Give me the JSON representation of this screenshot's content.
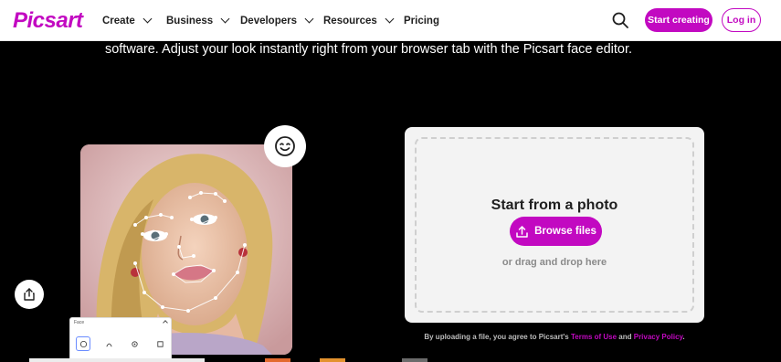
{
  "nav": {
    "logo": "Picsart",
    "menu": [
      {
        "label": "Create",
        "has_dropdown": true
      },
      {
        "label": "Business",
        "has_dropdown": true
      },
      {
        "label": "Developers",
        "has_dropdown": true
      },
      {
        "label": "Resources",
        "has_dropdown": true
      },
      {
        "label": "Pricing",
        "has_dropdown": false
      }
    ],
    "search_icon": "search-icon",
    "start_creating": "Start creating",
    "log_in": "Log in"
  },
  "hero": {
    "text": "software. Adjust your look instantly right from your browser tab with the Picsart face editor."
  },
  "upload": {
    "title": "Start from a photo",
    "browse_label": "Browse files",
    "drag_text": "or drag and drop here",
    "upload_icon": "upload-icon"
  },
  "terms": {
    "prefix": "By uploading a file, you agree to Picsart's ",
    "terms_link": "Terms of Use",
    "middle": " and ",
    "privacy_link": "Privacy Policy",
    "suffix": "."
  },
  "face_panel": {
    "title": "Face"
  },
  "colors": {
    "brand": "#c209c1",
    "background": "#000000",
    "card": "#f3f3f3"
  }
}
